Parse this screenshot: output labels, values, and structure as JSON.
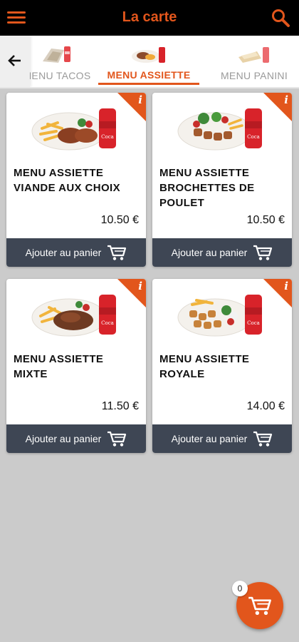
{
  "header": {
    "title": "La carte",
    "menu_icon": "hamburger-menu-icon",
    "search_icon": "search-icon"
  },
  "tabs": [
    {
      "label": "MENU TACOS",
      "active": false
    },
    {
      "label": "MENU ASSIETTE",
      "active": true
    },
    {
      "label": "MENU PANINI",
      "active": false
    }
  ],
  "products": [
    {
      "name": "MENU ASSIETTE VIANDE AUX CHOIX",
      "price": "10.50 €",
      "button": "Ajouter au panier"
    },
    {
      "name": "MENU ASSIETTE BROCHETTES DE POULET",
      "price": "10.50 €",
      "button": "Ajouter au panier"
    },
    {
      "name": "MENU ASSIETTE MIXTE",
      "price": "11.50 €",
      "button": "Ajouter au panier"
    },
    {
      "name": "MENU ASSIETTE ROYALE",
      "price": "14.00 €",
      "button": "Ajouter au panier"
    }
  ],
  "cart": {
    "count": "0"
  },
  "colors": {
    "accent": "#e2561c",
    "header_bg": "#000000",
    "button_bg": "#3e4654",
    "page_bg": "#cbcbcb"
  }
}
